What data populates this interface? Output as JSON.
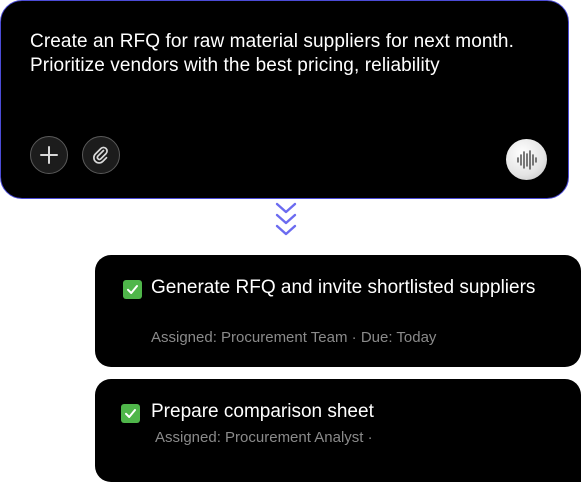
{
  "prompt": {
    "text": "Create an RFQ for raw material suppliers for next month. Prioritize vendors with the best pricing, reliability",
    "add_icon": "plus-icon",
    "attach_icon": "paperclip-icon",
    "voice_icon": "waveform-icon"
  },
  "connector": {
    "icon": "double-chevron-down-icon",
    "color": "#6b6bf0"
  },
  "tasks": [
    {
      "title": "Generate RFQ and invite shortlisted suppliers",
      "meta": "Assigned: Procurement Team · Due: Today",
      "checked": true
    },
    {
      "title": "Prepare comparison sheet",
      "meta": "Assigned: Procurement Analyst ·",
      "checked": true
    }
  ],
  "colors": {
    "card_bg": "#000000",
    "prompt_border": "#4b4bd6",
    "check_green": "#4fb64a",
    "meta_text": "#8a8a8a"
  }
}
